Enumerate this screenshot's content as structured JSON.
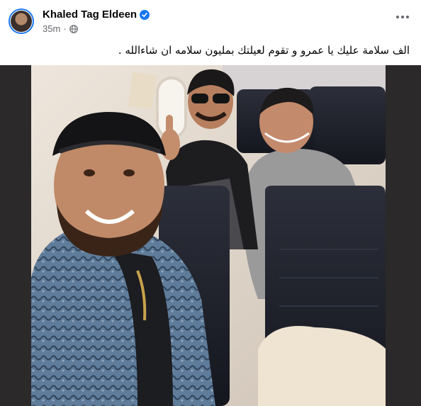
{
  "post": {
    "author": "Khaled Tag Eldeen",
    "timestamp": "35m",
    "separator": "·",
    "privacy_icon": "globe-icon",
    "verified_icon": "verified-badge-icon",
    "more_icon": "more-options-icon",
    "text": "الف سلامة عليك يا عمرو و تقوم لعيلتك بمليون سلامه ان شاءالله ."
  },
  "colors": {
    "brand": "#1877f2",
    "text": "#050505",
    "secondary_text": "#65676b",
    "photo_frame": "#2b292a"
  }
}
